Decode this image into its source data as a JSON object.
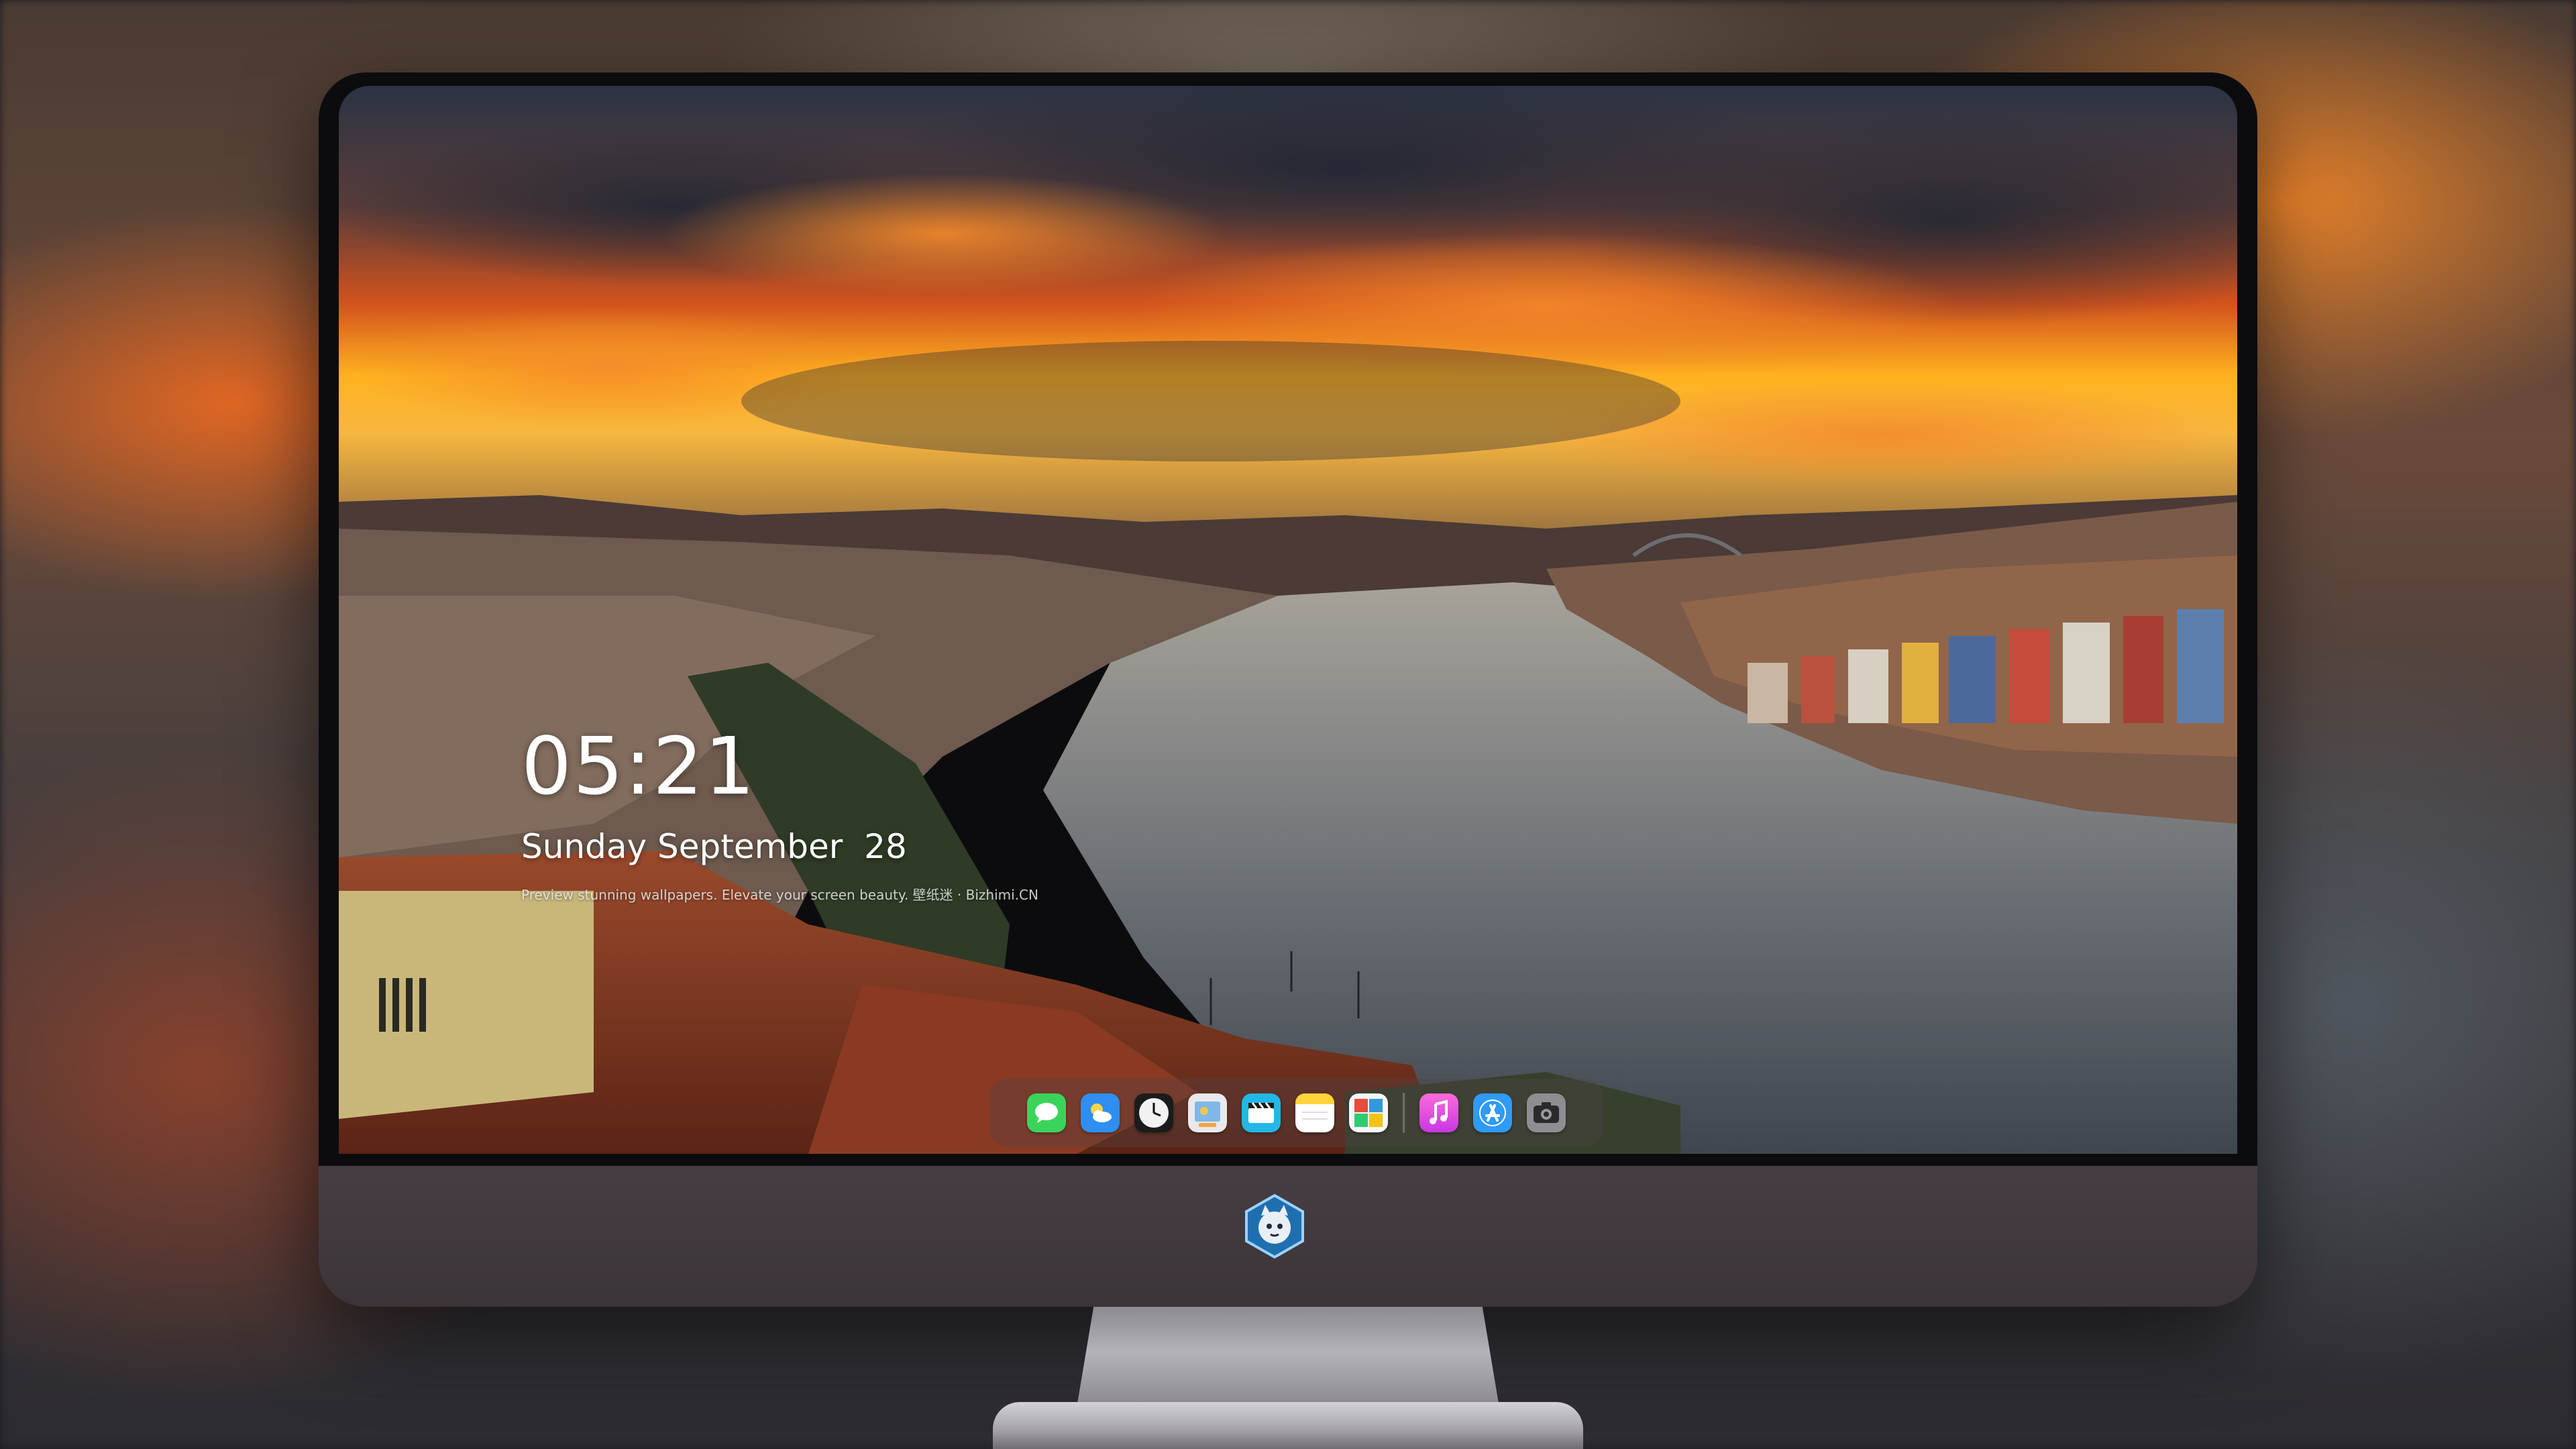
{
  "lock_screen": {
    "time": "05:21",
    "date": "Sunday September  28",
    "tagline": "Preview stunning wallpapers. Elevate your screen beauty. 壁纸迷 · Bizhimi.CN"
  },
  "dock": {
    "apps": [
      {
        "name": "messages-icon",
        "color": "#3bd45b"
      },
      {
        "name": "weather-icon",
        "color": "#2f8ef0"
      },
      {
        "name": "clock-icon",
        "color": "#f2f2f2"
      },
      {
        "name": "preview-icon",
        "color": "#d9d9d9"
      },
      {
        "name": "clips-icon",
        "color": "#22b7e6"
      },
      {
        "name": "notes-icon",
        "color": "#ffd33c"
      },
      {
        "name": "photo-booth-icon",
        "color": "#f7f7f7"
      },
      {
        "name": "music-icon",
        "color": "#fa4bd2"
      },
      {
        "name": "app-store-icon",
        "color": "#2f9af8"
      },
      {
        "name": "camera-icon",
        "color": "#8d8d92"
      }
    ]
  }
}
